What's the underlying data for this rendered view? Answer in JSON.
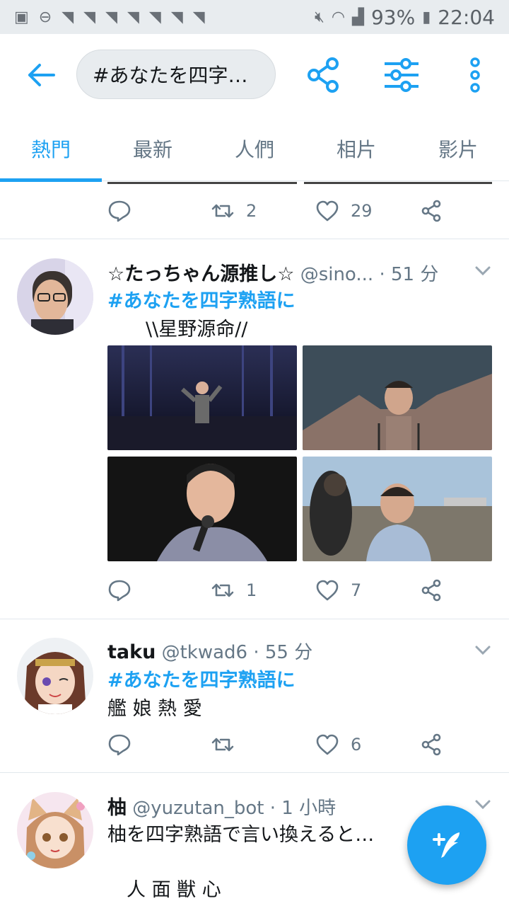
{
  "status_bar": {
    "battery": "93%",
    "time": "22:04"
  },
  "header": {
    "search_text": "#あなたを四字…"
  },
  "tabs": [
    {
      "label": "熱門",
      "active": true
    },
    {
      "label": "最新",
      "active": false
    },
    {
      "label": "人們",
      "active": false
    },
    {
      "label": "相片",
      "active": false
    },
    {
      "label": "影片",
      "active": false
    }
  ],
  "tweets": [
    {
      "retweets": "2",
      "likes": "29"
    },
    {
      "name": "☆たっちゃん源推し☆",
      "handle": "@sino...",
      "time": "· 51 分",
      "hashtag": "#あなたを四字熟語に",
      "text": "　　\\\\星野源命//",
      "retweets": "1",
      "likes": "7"
    },
    {
      "name": "taku",
      "handle": "@tkwad6",
      "time": "· 55 分",
      "hashtag": "#あなたを四字熟語に",
      "text": "艦 娘 熱 愛",
      "retweets": "",
      "likes": "6"
    },
    {
      "name": "柚",
      "handle": "@yuzutan_bot",
      "time": "· 1 小時",
      "text": "柚を四字熟語で言い換えると…",
      "text2": "　人 面 獣 心"
    }
  ],
  "colors": {
    "accent": "#1da1f2",
    "muted": "#657786",
    "status_bg": "#e8ecef"
  },
  "icons": [
    "back-arrow-icon",
    "share-icon",
    "filter-icon",
    "more-vertical-icon",
    "reply-icon",
    "retweet-icon",
    "like-icon",
    "compose-icon"
  ]
}
